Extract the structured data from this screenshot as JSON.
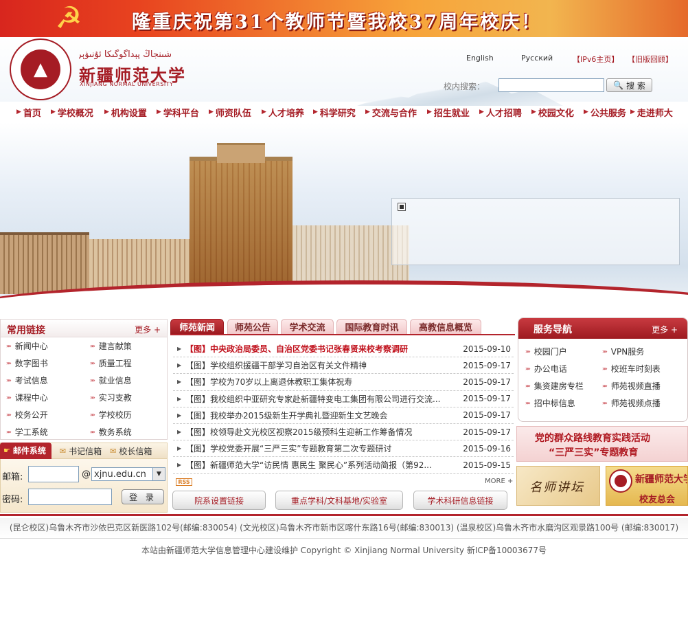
{
  "banner": {
    "title": "隆重庆祝第31个教师节暨我校37周年校庆！",
    "emblem_icon": "hammer-sickle-icon"
  },
  "logo": {
    "uyghur": "شىنجاڭ پېداگوگىكا ئۇنىۋېرسىتېتى",
    "chinese": "新疆师范大学",
    "english": "XINJIANG NORMAL UNIVERSITY"
  },
  "top_links": {
    "english": "English",
    "russian": "Русский",
    "ipv6": "【IPv6主页】",
    "old_version": "【旧版回顾】"
  },
  "search": {
    "label": "校内搜索：",
    "value": "",
    "button": "搜 索"
  },
  "nav": {
    "items": [
      "首页",
      "学校概况",
      "机构设置",
      "学科平台",
      "师资队伍",
      "人才培养",
      "科学研究",
      "交流与合作",
      "招生就业",
      "人才招聘",
      "校园文化",
      "公共服务",
      "走进师大"
    ]
  },
  "common_links": {
    "title": "常用链接",
    "more": "更多 +",
    "items": [
      "新闻中心",
      "建言献策",
      "数字图书",
      "质量工程",
      "考试信息",
      "就业信息",
      "课程中心",
      "实习支教",
      "校务公开",
      "学校校历",
      "学工系统",
      "教务系统"
    ]
  },
  "mail": {
    "tabs": [
      "邮件系统",
      "书记信箱",
      "校长信箱"
    ],
    "email_label": "邮箱:",
    "at": "@",
    "domain": "xjnu.edu.cn",
    "password_label": "密码:",
    "login": "登 录"
  },
  "news": {
    "tabs": [
      "师苑新闻",
      "师苑公告",
      "学术交流",
      "国际教育时讯",
      "高教信息概览"
    ],
    "items": [
      {
        "title": "【图】中央政治局委员、自治区党委书记张春贤来校考察调研",
        "date": "2015-09-10"
      },
      {
        "title": "【图】学校组织援疆干部学习自治区有关文件精神",
        "date": "2015-09-17"
      },
      {
        "title": "【图】学校为70岁以上离退休教职工集体祝寿",
        "date": "2015-09-17"
      },
      {
        "title": "【图】我校组织中亚研究专家赴新疆特变电工集团有限公司进行交流...",
        "date": "2015-09-17"
      },
      {
        "title": "【图】我校举办2015级新生开学典礼暨迎新生文艺晚会",
        "date": "2015-09-17"
      },
      {
        "title": "【图】校领导赴文光校区视察2015级预科生迎新工作筹备情况",
        "date": "2015-09-17"
      },
      {
        "title": "【图】学校党委开展“三严三实”专题教育第二次专题研讨",
        "date": "2015-09-16"
      },
      {
        "title": "【图】新疆师范大学“访民情 惠民生 聚民心”系列活动简报（第92...",
        "date": "2015-09-15"
      }
    ],
    "rss": "RSS",
    "more": "MORE +"
  },
  "bottom_links": [
    "院系设置链接",
    "重点学科/文科基地/实验室",
    "学术科研信息链接"
  ],
  "services": {
    "title": "服务导航",
    "more": "更多 +",
    "items": [
      "校园门户",
      "VPN服务",
      "办公电话",
      "校班车时刻表",
      "集资建房专栏",
      "师苑视频直播",
      "招中标信息",
      "师苑视频点播"
    ]
  },
  "promo": {
    "line1": "党的群众路线教育实践活动",
    "line2": "“三严三实”专题教育",
    "famous_teacher": "名师讲坛",
    "alumni_logo_cn": "新疆师范大学",
    "alumni": "校友总会"
  },
  "footer": {
    "address": "(昆仑校区)乌鲁木齐市沙依巴克区新医路102号(邮编:830054) (文光校区)乌鲁木齐市新市区喀什东路16号(邮编:830013) (温泉校区)乌鲁木齐市水磨沟区观景路100号 (邮编:830017)",
    "copyright": "本站由新疆师范大学信息管理中心建设维护 Copyright © Xinjiang Normal University 新ICP备10003677号"
  },
  "colors": {
    "brand_red": "#a51c24",
    "accent_red": "#b3242c",
    "banner_orange": "#f7a43a"
  }
}
